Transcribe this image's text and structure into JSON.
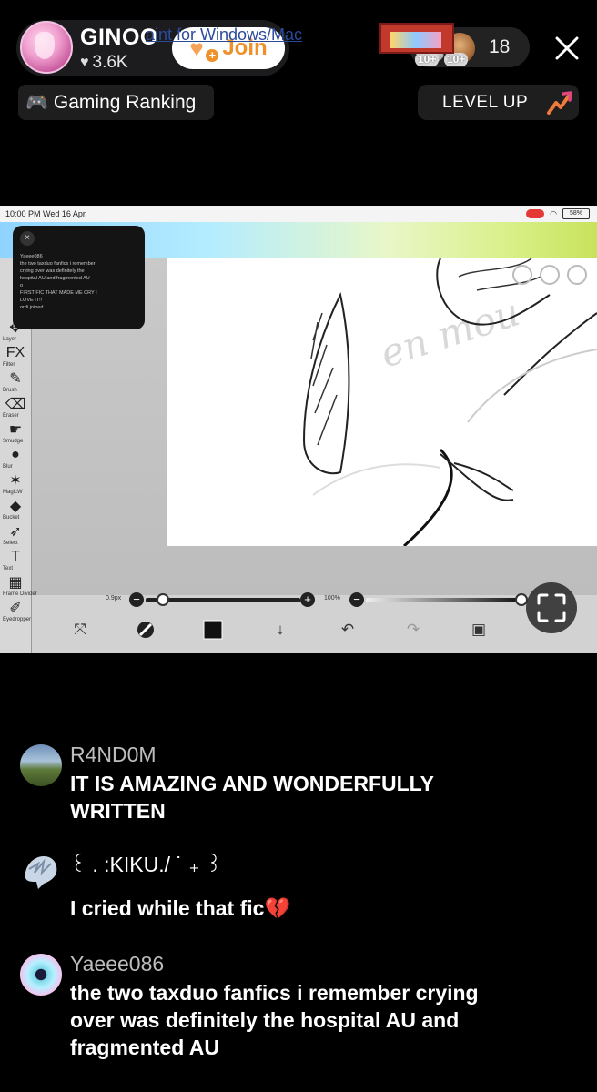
{
  "header": {
    "host_name": "GINOO",
    "host_likes": "3.6K",
    "join_label": "Join",
    "viewer_badges": [
      "10+",
      "10+"
    ],
    "viewer_count": "18",
    "ranking_label": "Gaming Ranking",
    "level_label": "LEVEL UP"
  },
  "stream": {
    "status_time": "10:00 PM  Wed 16 Apr",
    "battery": "58%",
    "banner_title": "aint for Windows/Mac",
    "overlay_lines": [
      "Yaeee086",
      "the two taxduo fanfics i remember",
      "crying over was definitely the",
      "hospital AU and fragmented AU",
      "o",
      "FIRST FIC THAT MADE ME CRY I",
      "LOVE IT!!",
      "ordi joined"
    ],
    "left_tools": [
      {
        "glyph": "✥",
        "sub": "Layer"
      },
      {
        "glyph": "FX",
        "sub": "Filter"
      },
      {
        "glyph": "✎",
        "sub": "Brush"
      },
      {
        "glyph": "⌫",
        "sub": "Eraser"
      },
      {
        "glyph": "☛",
        "sub": "Smudge"
      },
      {
        "glyph": "●",
        "sub": "Blur"
      },
      {
        "glyph": "✶",
        "sub": "MagicW"
      },
      {
        "glyph": "◆",
        "sub": "Bucket"
      },
      {
        "glyph": "➶",
        "sub": "Select"
      },
      {
        "glyph": "T",
        "sub": "Text"
      },
      {
        "glyph": "▦",
        "sub": "Frame Divider"
      },
      {
        "glyph": "✐",
        "sub": "Eyedropper"
      }
    ],
    "brush_size": "0.9px",
    "opacity": "100%"
  },
  "comments": [
    {
      "name": "R4ND0M",
      "text_lines": [
        "IT IS AMAZING AND WONDERFULLY",
        "WRITTEN"
      ]
    },
    {
      "name": "꒰ . :KIKU./ ˙ ₊ ꒱",
      "text": "I cried while that fic",
      "emoji": "💔"
    },
    {
      "name": "Yaeee086",
      "text_lines": [
        "the two taxduo fanfics i remember crying",
        "over was definitely the hospital AU and",
        "fragmented AU"
      ]
    }
  ],
  "colors": {
    "background": "#000000",
    "join_orange": "#f0902a",
    "pill_dark": "#1c1c1e",
    "comment_name": "#bdbdbd"
  }
}
